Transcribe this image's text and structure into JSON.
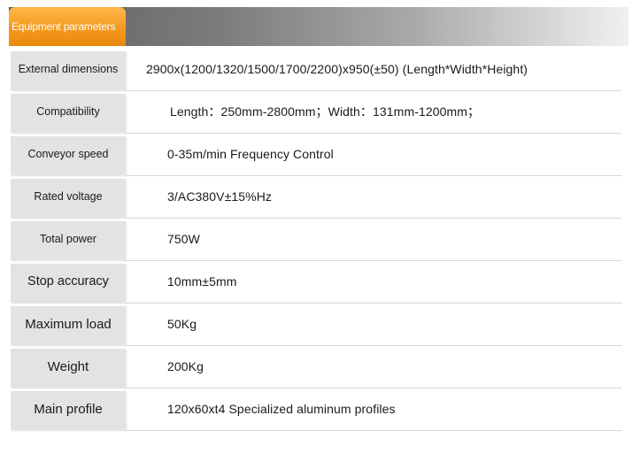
{
  "header": {
    "title": "Equipment parameters"
  },
  "rows": [
    {
      "label": "External dimensions",
      "value": "2900x(1200/1320/1500/1700/2200)x950(±50)  (Length*Width*Height)"
    },
    {
      "label": "Compatibility",
      "value": "Length：250mm-2800mm；Width：131mm-1200mm；"
    },
    {
      "label": "Conveyor speed",
      "value": "0-35m/min  Frequency Control"
    },
    {
      "label": "Rated voltage",
      "value": "3/AC380V±15%Hz"
    },
    {
      "label": "Total power",
      "value": "750W"
    },
    {
      "label": "Stop accuracy",
      "value": "10mm±5mm"
    },
    {
      "label": "Maximum load",
      "value": "50Kg"
    },
    {
      "label": "Weight",
      "value": "200Kg"
    },
    {
      "label": "Main profile",
      "value": "120x60xt4 Specialized aluminum profiles"
    }
  ],
  "colors": {
    "header_tab": "#f49a1e",
    "label_cell": "#e3e3e3"
  }
}
